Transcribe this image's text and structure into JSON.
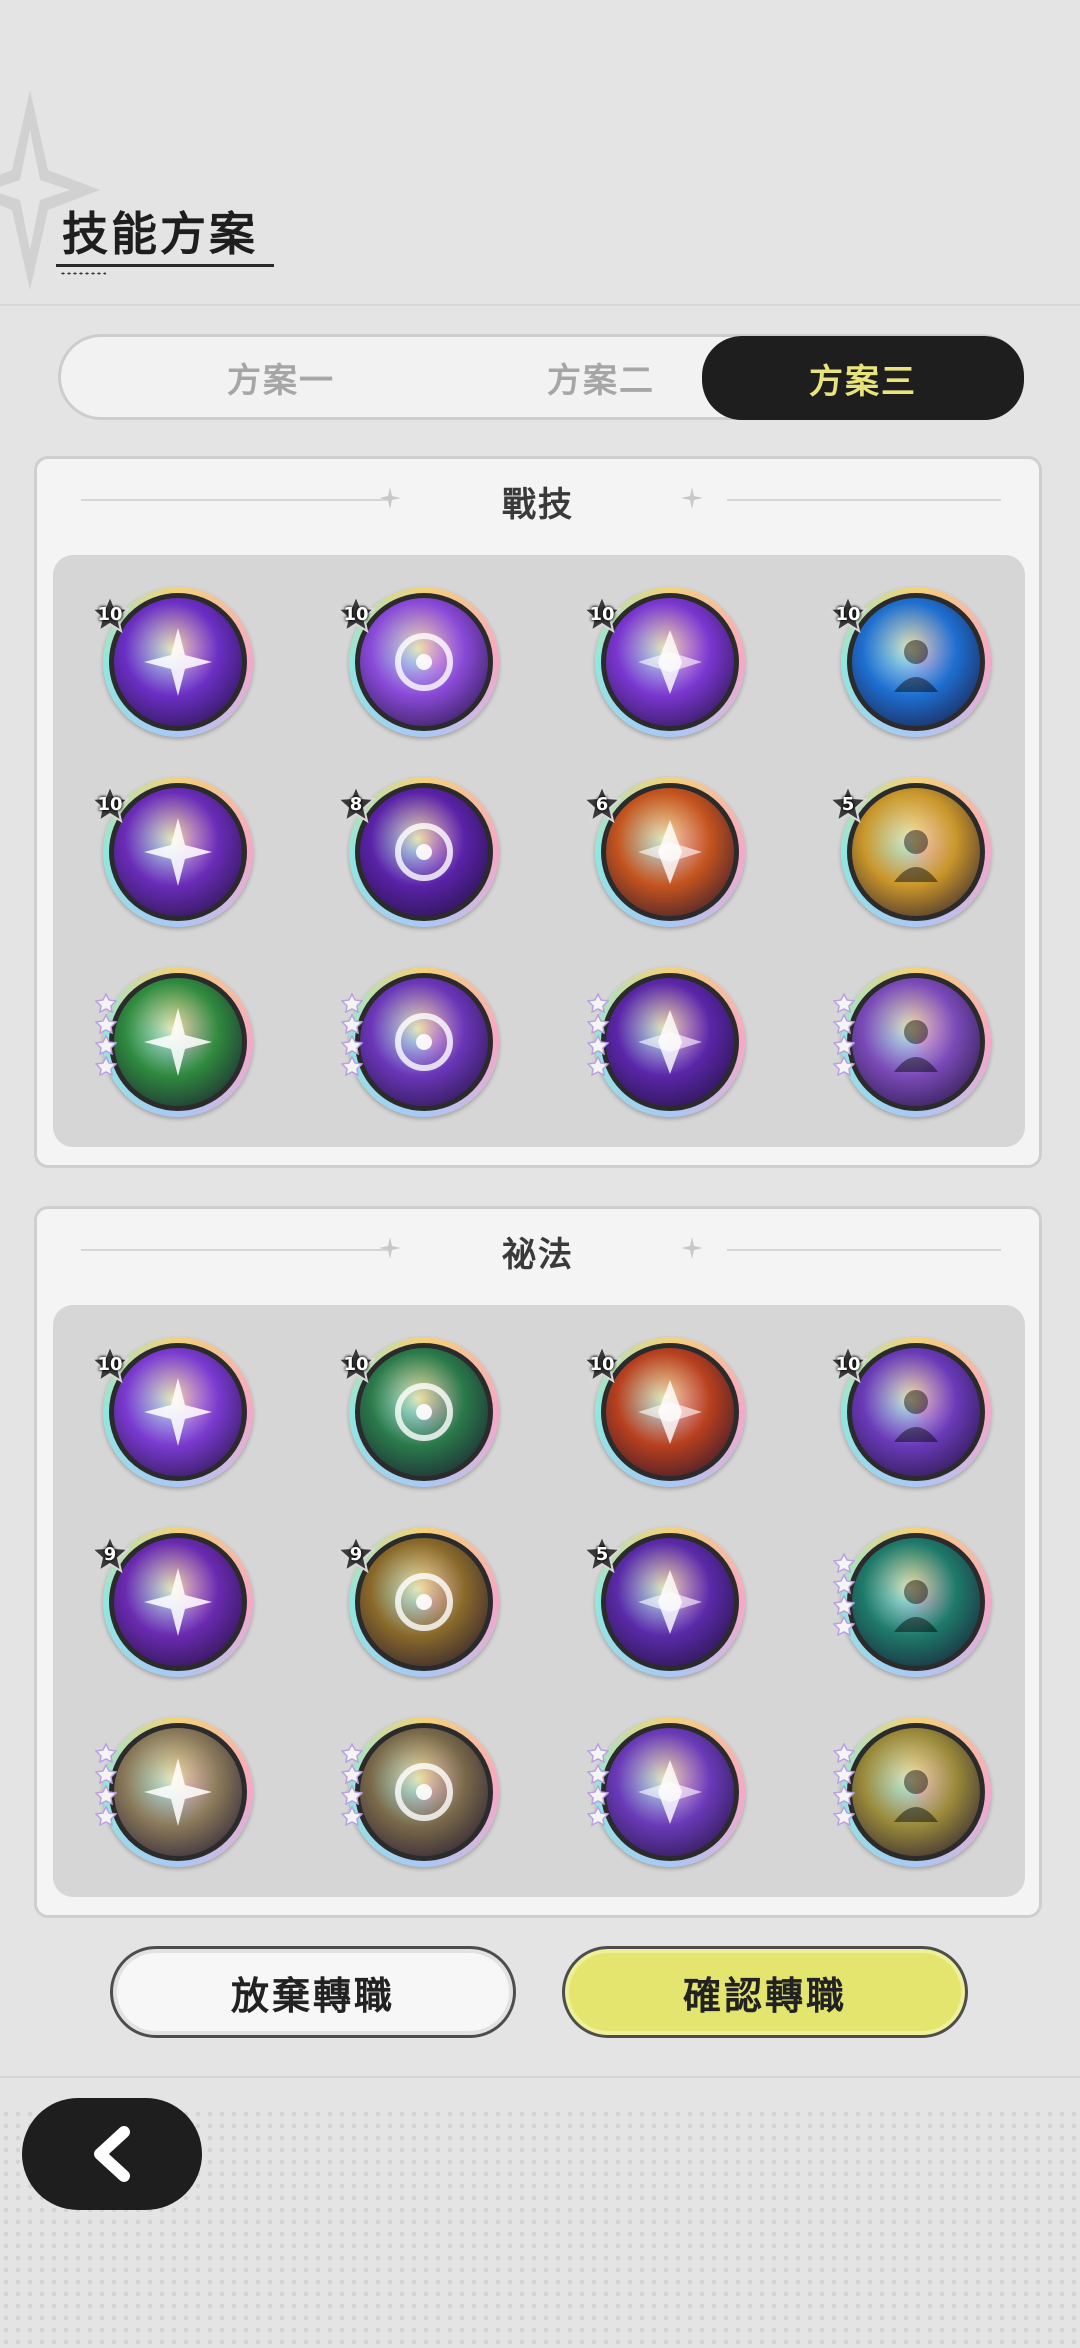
{
  "header": {
    "title": "技能方案"
  },
  "tabs": [
    {
      "label": "方案一",
      "active": false
    },
    {
      "label": "方案二",
      "active": false
    },
    {
      "label": "方案三",
      "active": true
    }
  ],
  "sections": {
    "combat": {
      "title": "戰技",
      "skills": [
        {
          "icon": "purple-star-burst-icon",
          "level": "10",
          "stars": 0,
          "color": "#6b2fc4"
        },
        {
          "icon": "purple-throne-icon",
          "level": "10",
          "stars": 0,
          "color": "#8a4ad8"
        },
        {
          "icon": "purple-shatter-icon",
          "level": "10",
          "stars": 0,
          "color": "#7a36d0"
        },
        {
          "icon": "blue-creature-icon",
          "level": "10",
          "stars": 0,
          "color": "#1e6fd0"
        },
        {
          "icon": "purple-hand-icon",
          "level": "10",
          "stars": 0,
          "color": "#6a2cb8"
        },
        {
          "icon": "purple-shield-emblem-icon",
          "level": "8",
          "stars": 0,
          "color": "#5a22a8"
        },
        {
          "icon": "orange-totem-icon",
          "level": "6",
          "stars": 0,
          "color": "#c4541e"
        },
        {
          "icon": "golden-sparkle-ring-icon",
          "level": "5",
          "stars": 0,
          "color": "#c9962a"
        },
        {
          "icon": "green-slash-icon",
          "level": "",
          "stars": 4,
          "color": "#2f8a3e"
        },
        {
          "icon": "purple-vortex-icon",
          "level": "",
          "stars": 4,
          "color": "#6a36b8"
        },
        {
          "icon": "purple-eye-icon",
          "level": "",
          "stars": 4,
          "color": "#5a26a8"
        },
        {
          "icon": "purple-sigil-icon",
          "level": "",
          "stars": 4,
          "color": "#7a4ab8"
        }
      ]
    },
    "arcane": {
      "title": "祕法",
      "skills": [
        {
          "icon": "purple-hooded-heart-icon",
          "level": "10",
          "stars": 0,
          "color": "#7a3ad0"
        },
        {
          "icon": "green-sparkle-icon",
          "level": "10",
          "stars": 0,
          "color": "#2a7a4a"
        },
        {
          "icon": "red-flame-shards-icon",
          "level": "10",
          "stars": 0,
          "color": "#b8401e"
        },
        {
          "icon": "purple-figure-arrows-icon",
          "level": "10",
          "stars": 0,
          "color": "#6a3ab8"
        },
        {
          "icon": "purple-gear-figure-icon",
          "level": "9",
          "stars": 0,
          "color": "#6a2ab0"
        },
        {
          "icon": "golden-praying-figure-icon",
          "level": "9",
          "stars": 0,
          "color": "#8a6a2a"
        },
        {
          "icon": "purple-flex-arm-icon",
          "level": "5",
          "stars": 0,
          "color": "#5a2aa8"
        },
        {
          "icon": "teal-bound-figure-icon",
          "level": "",
          "stars": 4,
          "color": "#1e7a6a"
        },
        {
          "icon": "beige-figure-icon",
          "level": "",
          "stars": 4,
          "color": "#8a7a5a"
        },
        {
          "icon": "beige-cone-icon",
          "level": "",
          "stars": 4,
          "color": "#7a6a4a"
        },
        {
          "icon": "purple-rose-icon",
          "level": "",
          "stars": 4,
          "color": "#6a3ab8"
        },
        {
          "icon": "golden-feather-icon",
          "level": "",
          "stars": 4,
          "color": "#9a8a3a"
        }
      ]
    }
  },
  "buttons": {
    "cancel": "放棄轉職",
    "confirm": "確認轉職"
  },
  "nav": {
    "back_icon": "chevron-left-icon"
  }
}
